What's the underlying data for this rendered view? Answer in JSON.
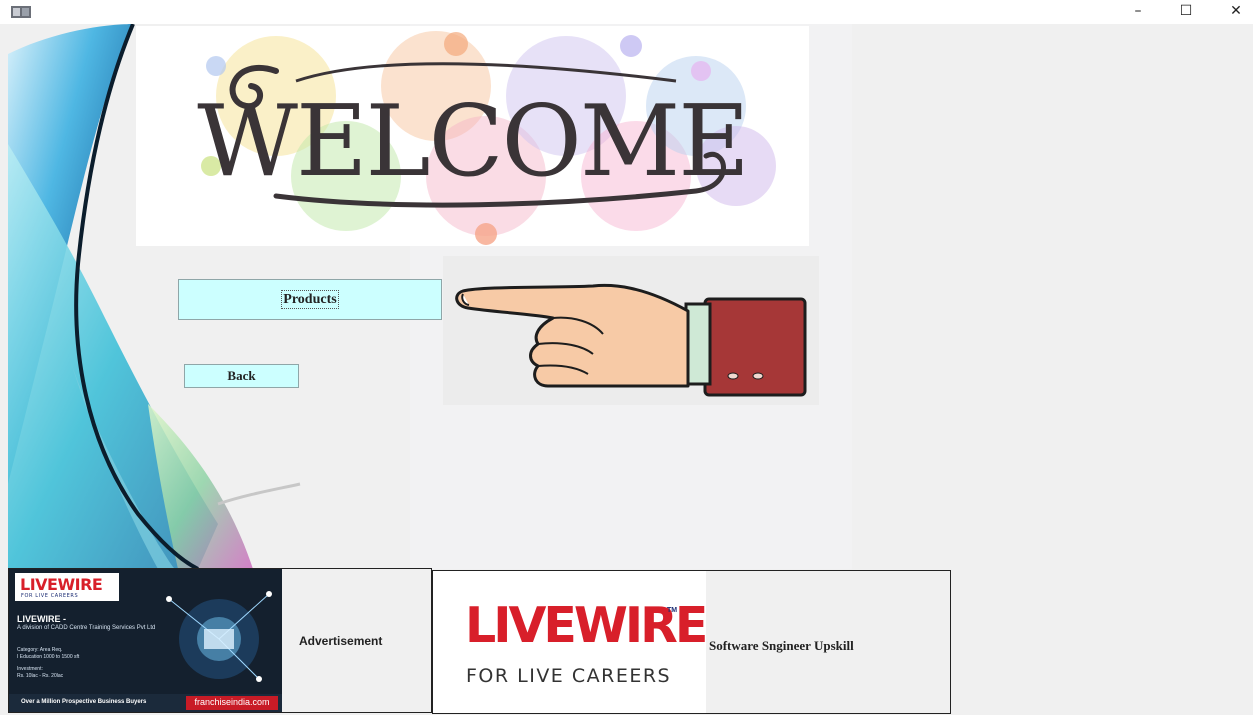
{
  "window": {
    "minimize_glyph": "–",
    "maximize_glyph": "☐",
    "close_glyph": "✕"
  },
  "banner": {
    "text": "WELCOME"
  },
  "buttons": {
    "products_label": "Products",
    "back_label": "Back"
  },
  "ad_livewire_franchise": {
    "logo_text": "LIVEWIRE",
    "logo_tagline": "FOR LIVE CAREERS",
    "title": "LIVEWIRE -",
    "description": "A division of CADD Centre Training Services Pvt Ltd",
    "category_line": "Category: Area Req.",
    "category_values": "I Education 1000 to 1500 sft",
    "investment_line": "Investment:",
    "investment_value": "Rs. 10lac - Rs. 20lac",
    "footer_text": "Over a Million Prospective Business Buyers",
    "footer_brand": "franchiseindia.com",
    "label": "Advertisement"
  },
  "ad_livewire_logo": {
    "logo_text": "LIVEWIRE",
    "trademark": "TM",
    "tagline": "FOR LIVE CAREERS",
    "label": "Software Sngineer Upskill"
  },
  "colors": {
    "button_bg": "#ccffff",
    "livewire_red": "#d81f2a",
    "livewire_blue": "#1c2d74"
  }
}
